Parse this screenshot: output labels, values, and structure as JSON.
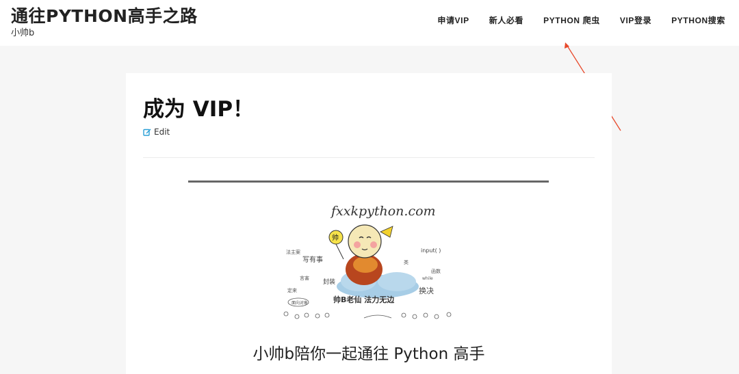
{
  "header": {
    "site_title": "通往PYTHON高手之路",
    "tagline": "小帅b",
    "nav": [
      {
        "label": "申请VIP"
      },
      {
        "label": "新人必看"
      },
      {
        "label": "PYTHON 爬虫"
      },
      {
        "label": "VIP登录"
      },
      {
        "label": "PYTHON搜索"
      }
    ]
  },
  "main": {
    "title": "成为 VIP！",
    "edit_label": "Edit",
    "logo_text": "fxxkpython.com",
    "caption": "小帅b陪你一起通往 Python 高手"
  },
  "colors": {
    "arrow": "#e8492b",
    "edit_icon": "#2a9fd6"
  }
}
